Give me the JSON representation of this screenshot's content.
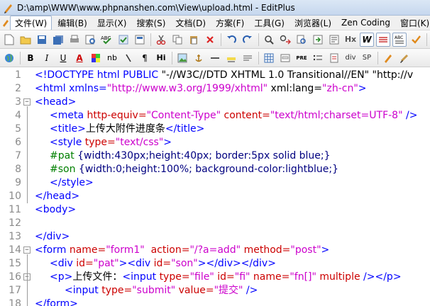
{
  "window": {
    "title": "D:\\amp\\WWW\\www.phpnanshen.com\\View\\upload.html - EditPlus"
  },
  "menu": [
    {
      "label": "文件(W)",
      "active": true
    },
    {
      "label": "编辑(B)"
    },
    {
      "label": "显示(X)"
    },
    {
      "label": "搜索(S)"
    },
    {
      "label": "文档(D)"
    },
    {
      "label": "方案(F)"
    },
    {
      "label": "工具(G)"
    },
    {
      "label": "浏览器(L)"
    },
    {
      "label": "Zen Coding"
    },
    {
      "label": "窗口(K)"
    }
  ],
  "toolbar_text": {
    "bold": "B",
    "italic": "I",
    "underline": "U",
    "font_color": "A",
    "nbsp": "nb",
    "para": "¶",
    "heading": "Hi",
    "hx": "Hx",
    "wrap": "W",
    "div": "div",
    "span": "SP",
    "abc": "ABC"
  },
  "colors": {
    "tag": "#0000ff",
    "attribute": "#cc0000",
    "value": "#cc00cc",
    "css_selector": "#008000",
    "line_number": "#8a8a8a"
  },
  "lines": [
    {
      "n": "1",
      "indent": 0,
      "tokens": [
        {
          "t": "<!DOCTYPE html PUBLIC ",
          "c": "tag"
        },
        {
          "t": "\"-//W3C//DTD XHTML 1.0 Transitional//EN\" \"http://v",
          "c": "txt"
        }
      ]
    },
    {
      "n": "2",
      "indent": 0,
      "tokens": [
        {
          "t": "<html ",
          "c": "tag"
        },
        {
          "t": "xmlns=",
          "c": "tag"
        },
        {
          "t": "\"http://www.w3.org/1999/xhtml\"",
          "c": "val"
        },
        {
          "t": " xml:lang=",
          "c": "txt"
        },
        {
          "t": "\"zh-cn\"",
          "c": "val"
        },
        {
          "t": ">",
          "c": "tag"
        }
      ]
    },
    {
      "n": "3",
      "indent": 0,
      "fold": "-",
      "tokens": [
        {
          "t": "<head>",
          "c": "tag"
        }
      ]
    },
    {
      "n": "4",
      "indent": 1,
      "tokens": [
        {
          "t": "<meta ",
          "c": "tag"
        },
        {
          "t": "http-equiv=",
          "c": "attr"
        },
        {
          "t": "\"Content-Type\"",
          "c": "val"
        },
        {
          "t": " content=",
          "c": "attr"
        },
        {
          "t": "\"text/html;charset=UTF-8\"",
          "c": "val"
        },
        {
          "t": " />",
          "c": "tag"
        }
      ]
    },
    {
      "n": "5",
      "indent": 1,
      "tokens": [
        {
          "t": "<title>",
          "c": "tag"
        },
        {
          "t": "上传大附件进度条",
          "c": "txt"
        },
        {
          "t": "</title>",
          "c": "tag"
        }
      ]
    },
    {
      "n": "6",
      "indent": 1,
      "tokens": [
        {
          "t": "<style ",
          "c": "tag"
        },
        {
          "t": "type=",
          "c": "attr"
        },
        {
          "t": "\"text/css\"",
          "c": "val"
        },
        {
          "t": ">",
          "c": "tag"
        }
      ]
    },
    {
      "n": "7",
      "indent": 1,
      "tokens": [
        {
          "t": "#pat ",
          "c": "css"
        },
        {
          "t": "{width:430px;height:40px; border:5px solid blue;}",
          "c": "cssv"
        }
      ]
    },
    {
      "n": "8",
      "indent": 1,
      "tokens": [
        {
          "t": "#son ",
          "c": "css"
        },
        {
          "t": "{width:0;height:100%; background-color:lightblue;}",
          "c": "cssv"
        }
      ]
    },
    {
      "n": "9",
      "indent": 1,
      "tokens": [
        {
          "t": "</style>",
          "c": "tag"
        }
      ]
    },
    {
      "n": "10",
      "indent": 0,
      "tokens": [
        {
          "t": "</head>",
          "c": "tag"
        }
      ]
    },
    {
      "n": "11",
      "indent": 0,
      "tokens": [
        {
          "t": "<body>",
          "c": "tag"
        }
      ]
    },
    {
      "n": "12",
      "indent": 0,
      "tokens": []
    },
    {
      "n": "13",
      "indent": 0,
      "tokens": [
        {
          "t": "</div>",
          "c": "tag"
        }
      ]
    },
    {
      "n": "14",
      "indent": 0,
      "fold": "-",
      "tokens": [
        {
          "t": "<form ",
          "c": "tag"
        },
        {
          "t": "name=",
          "c": "attr"
        },
        {
          "t": "\"form1\"",
          "c": "val"
        },
        {
          "t": "  action=",
          "c": "attr"
        },
        {
          "t": "\"/?a=add\"",
          "c": "val"
        },
        {
          "t": " method=",
          "c": "attr"
        },
        {
          "t": "\"post\"",
          "c": "val"
        },
        {
          "t": ">",
          "c": "tag"
        }
      ]
    },
    {
      "n": "15",
      "indent": 1,
      "tokens": [
        {
          "t": "<div ",
          "c": "tag"
        },
        {
          "t": "id=",
          "c": "attr"
        },
        {
          "t": "\"pat\"",
          "c": "val"
        },
        {
          "t": "><div ",
          "c": "tag"
        },
        {
          "t": "id=",
          "c": "attr"
        },
        {
          "t": "\"son\"",
          "c": "val"
        },
        {
          "t": "></div></div>",
          "c": "tag"
        }
      ]
    },
    {
      "n": "16",
      "indent": 1,
      "fold": "-",
      "tokens": [
        {
          "t": "<p>",
          "c": "tag"
        },
        {
          "t": "上传文件：",
          "c": "txt"
        },
        {
          "t": "<input ",
          "c": "tag"
        },
        {
          "t": "type=",
          "c": "attr"
        },
        {
          "t": "\"file\"",
          "c": "val"
        },
        {
          "t": " id=",
          "c": "attr"
        },
        {
          "t": "\"fi\"",
          "c": "val"
        },
        {
          "t": " name=",
          "c": "attr"
        },
        {
          "t": "\"fn[]\"",
          "c": "val"
        },
        {
          "t": " multiple ",
          "c": "attr"
        },
        {
          "t": "/></p>",
          "c": "tag"
        }
      ]
    },
    {
      "n": "17",
      "indent": 2,
      "tokens": [
        {
          "t": "<input ",
          "c": "tag"
        },
        {
          "t": "type=",
          "c": "attr"
        },
        {
          "t": "\"submit\"",
          "c": "val"
        },
        {
          "t": " value=",
          "c": "attr"
        },
        {
          "t": "\"提交\"",
          "c": "val"
        },
        {
          "t": " />",
          "c": "tag"
        }
      ]
    },
    {
      "n": "18",
      "indent": 0,
      "tokens": [
        {
          "t": "</form>",
          "c": "tag"
        }
      ]
    }
  ]
}
